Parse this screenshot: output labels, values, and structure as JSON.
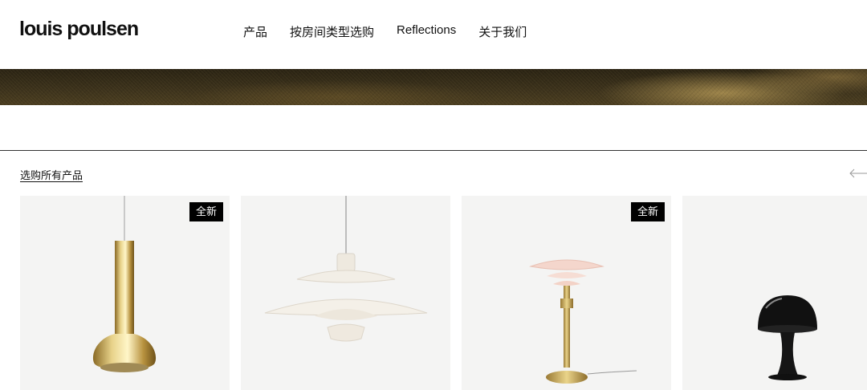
{
  "header": {
    "logo": "louis poulsen",
    "nav": [
      {
        "label": "产品"
      },
      {
        "label": "按房间类型选购"
      },
      {
        "label": "Reflections"
      },
      {
        "label": "关于我们"
      }
    ]
  },
  "section": {
    "shop_all_label": "选购所有产品",
    "prev_arrow_icon": "arrow-left-icon"
  },
  "products": [
    {
      "badge": "全新",
      "image": "brass-pendant-lamp"
    },
    {
      "badge": "",
      "image": "white-tiered-pendant-lamp"
    },
    {
      "badge": "全新",
      "image": "pink-tiered-table-lamp"
    },
    {
      "badge": "",
      "image": "black-mushroom-table-lamp"
    }
  ],
  "colors": {
    "badge_bg": "#000000",
    "card_bg": "#f4f4f3",
    "hero_gold": "#b8985a"
  }
}
